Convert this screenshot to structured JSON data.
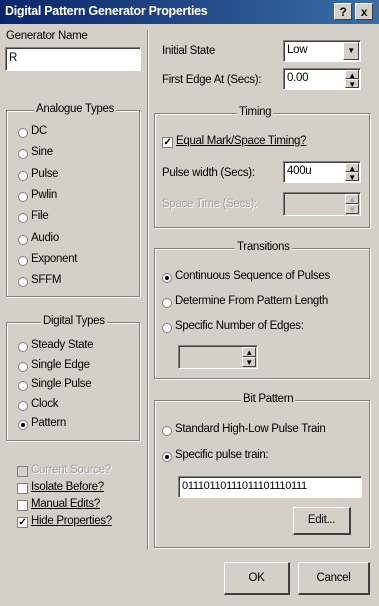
{
  "window": {
    "title": "Digital Pattern Generator Properties",
    "help_button": "?",
    "close_button": "x"
  },
  "generator_name": {
    "label": "Generator Name",
    "value": "R"
  },
  "analogue_types": {
    "title": "Analogue Types",
    "options": [
      "DC",
      "Sine",
      "Pulse",
      "Pwlin",
      "File",
      "Audio",
      "Exponent",
      "SFFM"
    ]
  },
  "digital_types": {
    "title": "Digital Types",
    "options": [
      "Steady State",
      "Single Edge",
      "Single Pulse",
      "Clock",
      "Pattern"
    ],
    "selected": "Pattern"
  },
  "checkboxes": {
    "current_source": {
      "label": "Current Source?",
      "checked": false,
      "enabled": false
    },
    "isolate_before": {
      "label": "Isolate Before?",
      "checked": false
    },
    "manual_edits": {
      "label": "Manual Edits?",
      "checked": false
    },
    "hide_properties": {
      "label": "Hide Properties?",
      "checked": true
    }
  },
  "initial_state": {
    "label": "Initial State",
    "value": "Low"
  },
  "first_edge": {
    "label": "First Edge At (Secs):",
    "value": "0.00"
  },
  "timing": {
    "title": "Timing",
    "equal_mark_space": {
      "label": "Equal Mark/Space Timing?",
      "checked": true
    },
    "pulse_width": {
      "label": "Pulse width (Secs):",
      "value": "400u"
    },
    "space_time": {
      "label": "Space Time (Secs):",
      "value": ""
    }
  },
  "transitions": {
    "title": "Transitions",
    "options": [
      "Continuous Sequence of Pulses",
      "Determine From Pattern Length",
      "Specific Number of Edges:"
    ],
    "selected": "Continuous Sequence of Pulses",
    "edges_value": ""
  },
  "bit_pattern": {
    "title": "Bit Pattern",
    "options": [
      "Standard High-Low Pulse Train",
      "Specific pulse train:"
    ],
    "selected": "Specific pulse train:",
    "pattern_value": "01110110111011101110111",
    "edit_button": "Edit..."
  },
  "buttons": {
    "ok": "OK",
    "cancel": "Cancel"
  }
}
